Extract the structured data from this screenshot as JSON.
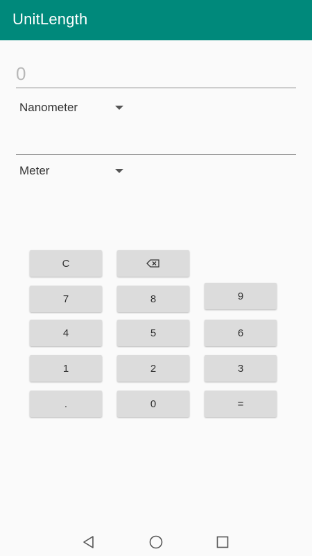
{
  "app": {
    "title": "UnitLength"
  },
  "from": {
    "value": "0",
    "unit": "Nanometer"
  },
  "to": {
    "value": "",
    "unit": "Meter"
  },
  "keypad": {
    "clear": "C",
    "backspace_icon": "backspace-icon",
    "k9": "9",
    "k8": "8",
    "k7": "7",
    "k6": "6",
    "k5": "5",
    "k4": "4",
    "k3": "3",
    "k2": "2",
    "k1": "1",
    "dot": ".",
    "k0": "0",
    "equals": "="
  },
  "nav": {
    "back_icon": "back-icon",
    "home_icon": "home-icon",
    "recents_icon": "recents-icon"
  },
  "colors": {
    "accent": "#00897b",
    "key": "#dcdcdc",
    "background": "#fafafa"
  }
}
